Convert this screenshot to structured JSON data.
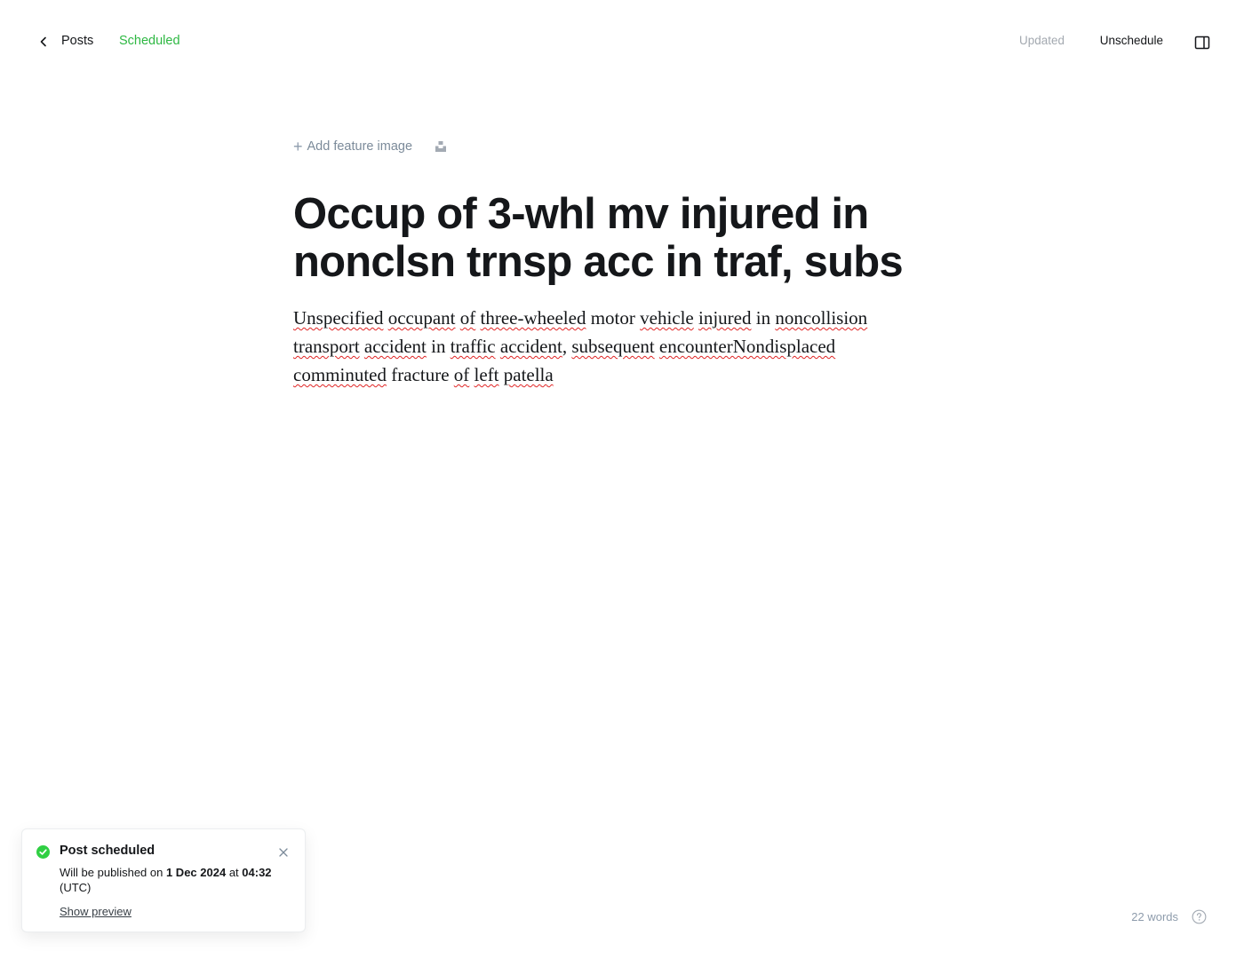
{
  "header": {
    "back_label": "Posts",
    "status_label": "Scheduled",
    "save_status": "Updated",
    "unschedule_label": "Unschedule",
    "back_icon": "chevron-left-icon",
    "settings_icon": "sidebar-toggle-icon"
  },
  "editor": {
    "add_feature_image": "Add feature image",
    "title": "Occup of 3-whl mv injured in nonclsn trnsp acc in traf, subs",
    "body_words": [
      {
        "t": "Unspecified",
        "err": true
      },
      {
        "t": " ",
        "err": false
      },
      {
        "t": "occupant",
        "err": true
      },
      {
        "t": " ",
        "err": false
      },
      {
        "t": "of",
        "err": true
      },
      {
        "t": " ",
        "err": false
      },
      {
        "t": "three-wheeled",
        "err": true
      },
      {
        "t": " motor ",
        "err": false
      },
      {
        "t": "vehicle",
        "err": true
      },
      {
        "t": " ",
        "err": false
      },
      {
        "t": "injured",
        "err": true
      },
      {
        "t": " in ",
        "err": false
      },
      {
        "t": "noncollision",
        "err": true
      },
      {
        "t": " ",
        "err": false
      },
      {
        "t": "transport",
        "err": true
      },
      {
        "t": " ",
        "err": false
      },
      {
        "t": "accident",
        "err": true
      },
      {
        "t": " in ",
        "err": false
      },
      {
        "t": "traffic",
        "err": true
      },
      {
        "t": " ",
        "err": false
      },
      {
        "t": "accident",
        "err": true
      },
      {
        "t": ", ",
        "err": false
      },
      {
        "t": "subsequent",
        "err": true
      },
      {
        "t": " ",
        "err": false
      },
      {
        "t": "encounterNondisplaced",
        "err": true
      },
      {
        "t": " ",
        "err": false
      },
      {
        "t": "comminuted",
        "err": true
      },
      {
        "t": " fracture ",
        "err": false
      },
      {
        "t": "of",
        "err": true
      },
      {
        "t": " ",
        "err": false
      },
      {
        "t": "left",
        "err": true
      },
      {
        "t": " ",
        "err": false
      },
      {
        "t": "patella",
        "err": true
      }
    ]
  },
  "toast": {
    "title": "Post scheduled",
    "msg_prefix": "Will be published on ",
    "msg_date": "1 Dec 2024",
    "msg_mid": " at ",
    "msg_time": "04:32",
    "msg_suffix": " (UTC)",
    "link_label": "Show preview",
    "success_color": "#30cf43"
  },
  "footer": {
    "word_count": "22 words",
    "help_icon": "question-circle-icon"
  }
}
